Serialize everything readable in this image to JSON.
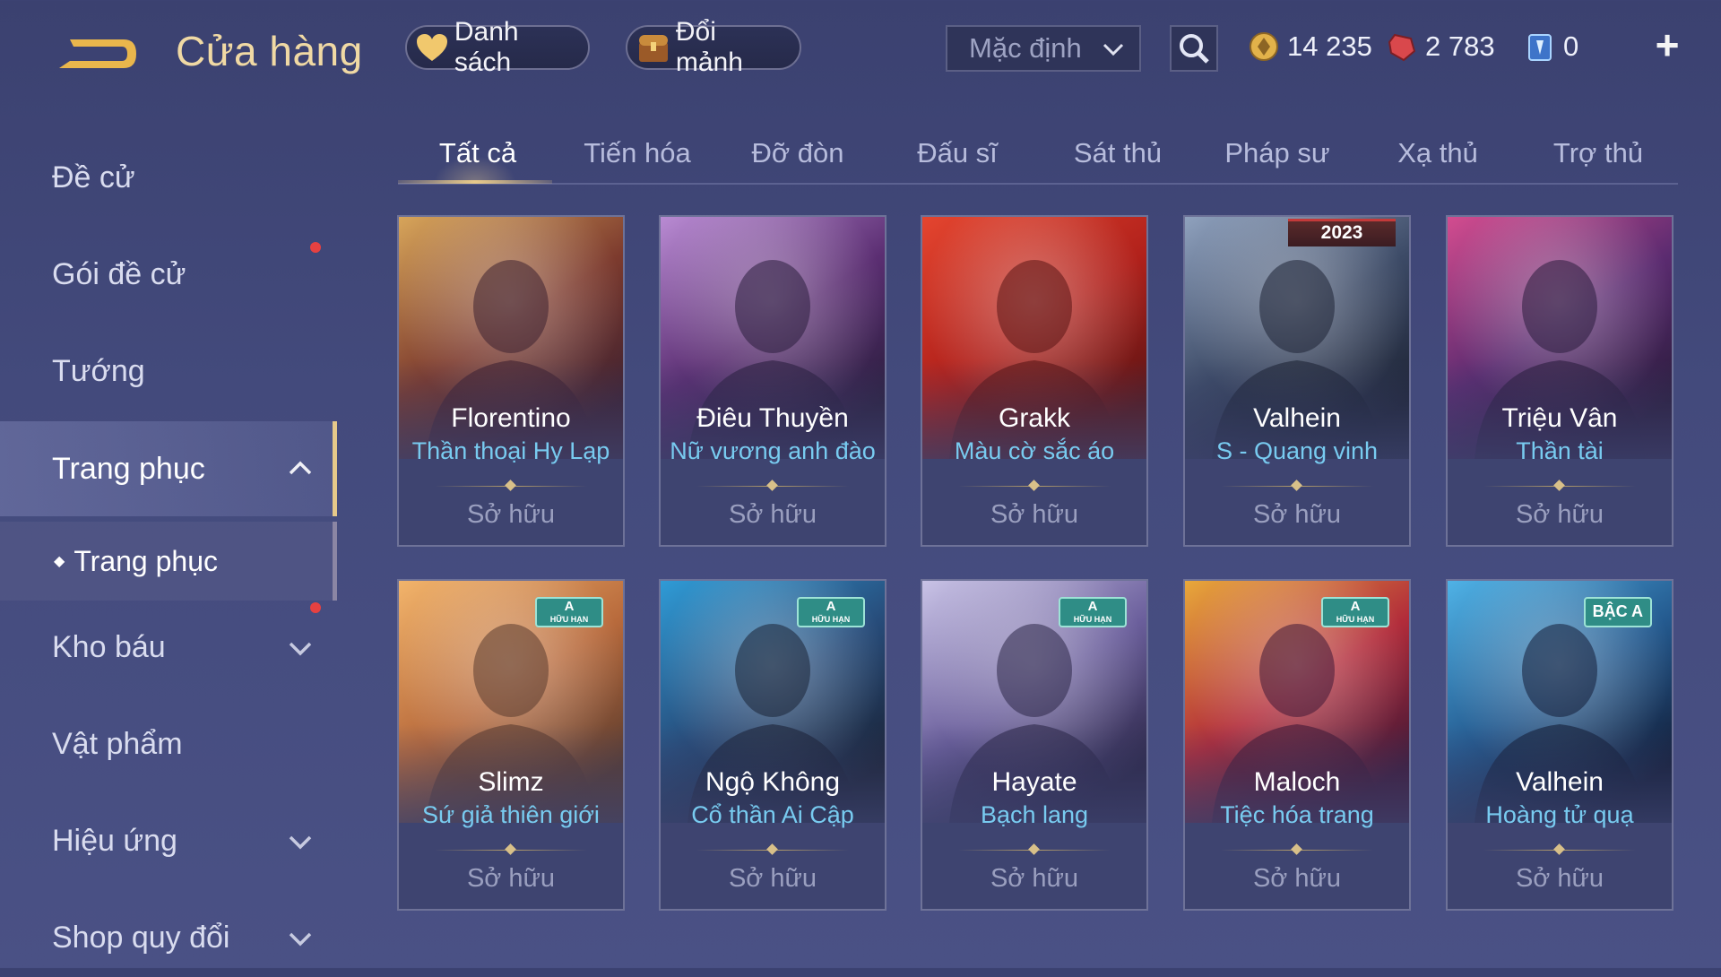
{
  "header": {
    "title": "Cửa hàng",
    "wishlist_label": "Danh sách",
    "exchange_label": "Đổi mảnh",
    "sort": {
      "selected": "Mặc định"
    },
    "currencies": [
      {
        "name": "gold",
        "value": "14 235"
      },
      {
        "name": "vouchers",
        "value": "2 783"
      },
      {
        "name": "crystal",
        "value": "0"
      }
    ]
  },
  "sidebar": {
    "items": [
      {
        "label": "Đề cử"
      },
      {
        "label": "Gói đề cử"
      },
      {
        "label": "Tướng"
      },
      {
        "label": "Trang phục"
      },
      {
        "label": "Kho báu"
      },
      {
        "label": "Vật phẩm"
      },
      {
        "label": "Hiệu ứng"
      },
      {
        "label": "Shop quy đổi"
      }
    ],
    "sub_item": "Trang phục"
  },
  "tabs": [
    "Tất cả",
    "Tiến hóa",
    "Đỡ đòn",
    "Đấu sĩ",
    "Sát thủ",
    "Pháp sư",
    "Xạ thủ",
    "Trợ thủ"
  ],
  "cards": [
    {
      "hero": "Florentino",
      "skin": "Thần thoại Hy Lạp",
      "status": "Sở hữu",
      "badge_top": "",
      "badge_sub": "",
      "palette": [
        "#d7a55a",
        "#7d3b2e",
        "#3d2030"
      ]
    },
    {
      "hero": "Điêu Thuyền",
      "skin": "Nữ vương anh đào",
      "status": "Sở hữu",
      "badge_top": "",
      "badge_sub": "",
      "palette": [
        "#b98bd3",
        "#5b2e72",
        "#2a1e3d"
      ]
    },
    {
      "hero": "Grakk",
      "skin": "Màu cờ sắc áo",
      "status": "Sở hữu",
      "badge_top": "",
      "badge_sub": "",
      "palette": [
        "#e4452f",
        "#b1211b",
        "#5a1414"
      ]
    },
    {
      "hero": "Valhein",
      "skin": "S - Quang vinh",
      "status": "Sở hữu",
      "badge_top": "2023",
      "badge_sub": "",
      "palette": [
        "#8fa1bd",
        "#3c4a66",
        "#1d2334"
      ]
    },
    {
      "hero": "Triệu Vân",
      "skin": "Thần tài",
      "status": "Sở hữu",
      "badge_top": "",
      "badge_sub": "",
      "palette": [
        "#d34c8f",
        "#5b2b70",
        "#2a1c3c"
      ]
    },
    {
      "hero": "Slimz",
      "skin": "Sứ giả thiên giới",
      "status": "Sở hữu",
      "badge_top": "A",
      "badge_sub": "HỮU HẠN",
      "palette": [
        "#f2b46b",
        "#b86a3c",
        "#5a3b2e"
      ]
    },
    {
      "hero": "Ngộ Không",
      "skin": "Cổ thần Ai Cập",
      "status": "Sở hữu",
      "badge_top": "A",
      "badge_sub": "HỮU HẠN",
      "palette": [
        "#2f9bd6",
        "#274c7a",
        "#1a2235"
      ]
    },
    {
      "hero": "Hayate",
      "skin": "Bạch lang",
      "status": "Sở hữu",
      "badge_top": "A",
      "badge_sub": "HỮU HẠN",
      "palette": [
        "#c9c3e6",
        "#6b5f9c",
        "#2b2647"
      ]
    },
    {
      "hero": "Maloch",
      "skin": "Tiệc hóa trang",
      "status": "Sở hữu",
      "badge_top": "A",
      "badge_sub": "HỮU HẠN",
      "palette": [
        "#e8a83a",
        "#b22c3a",
        "#3f1736"
      ]
    },
    {
      "hero": "Valhein",
      "skin": "Hoàng tử quạ",
      "status": "Sở hữu",
      "badge_top": "BẬC A",
      "badge_sub": "",
      "palette": [
        "#4fb2e6",
        "#245a8f",
        "#121c36"
      ]
    }
  ],
  "colors": {
    "accent_gold": "#e7c98a",
    "skin_blue": "#78cbf0",
    "notification": "#e64141"
  }
}
